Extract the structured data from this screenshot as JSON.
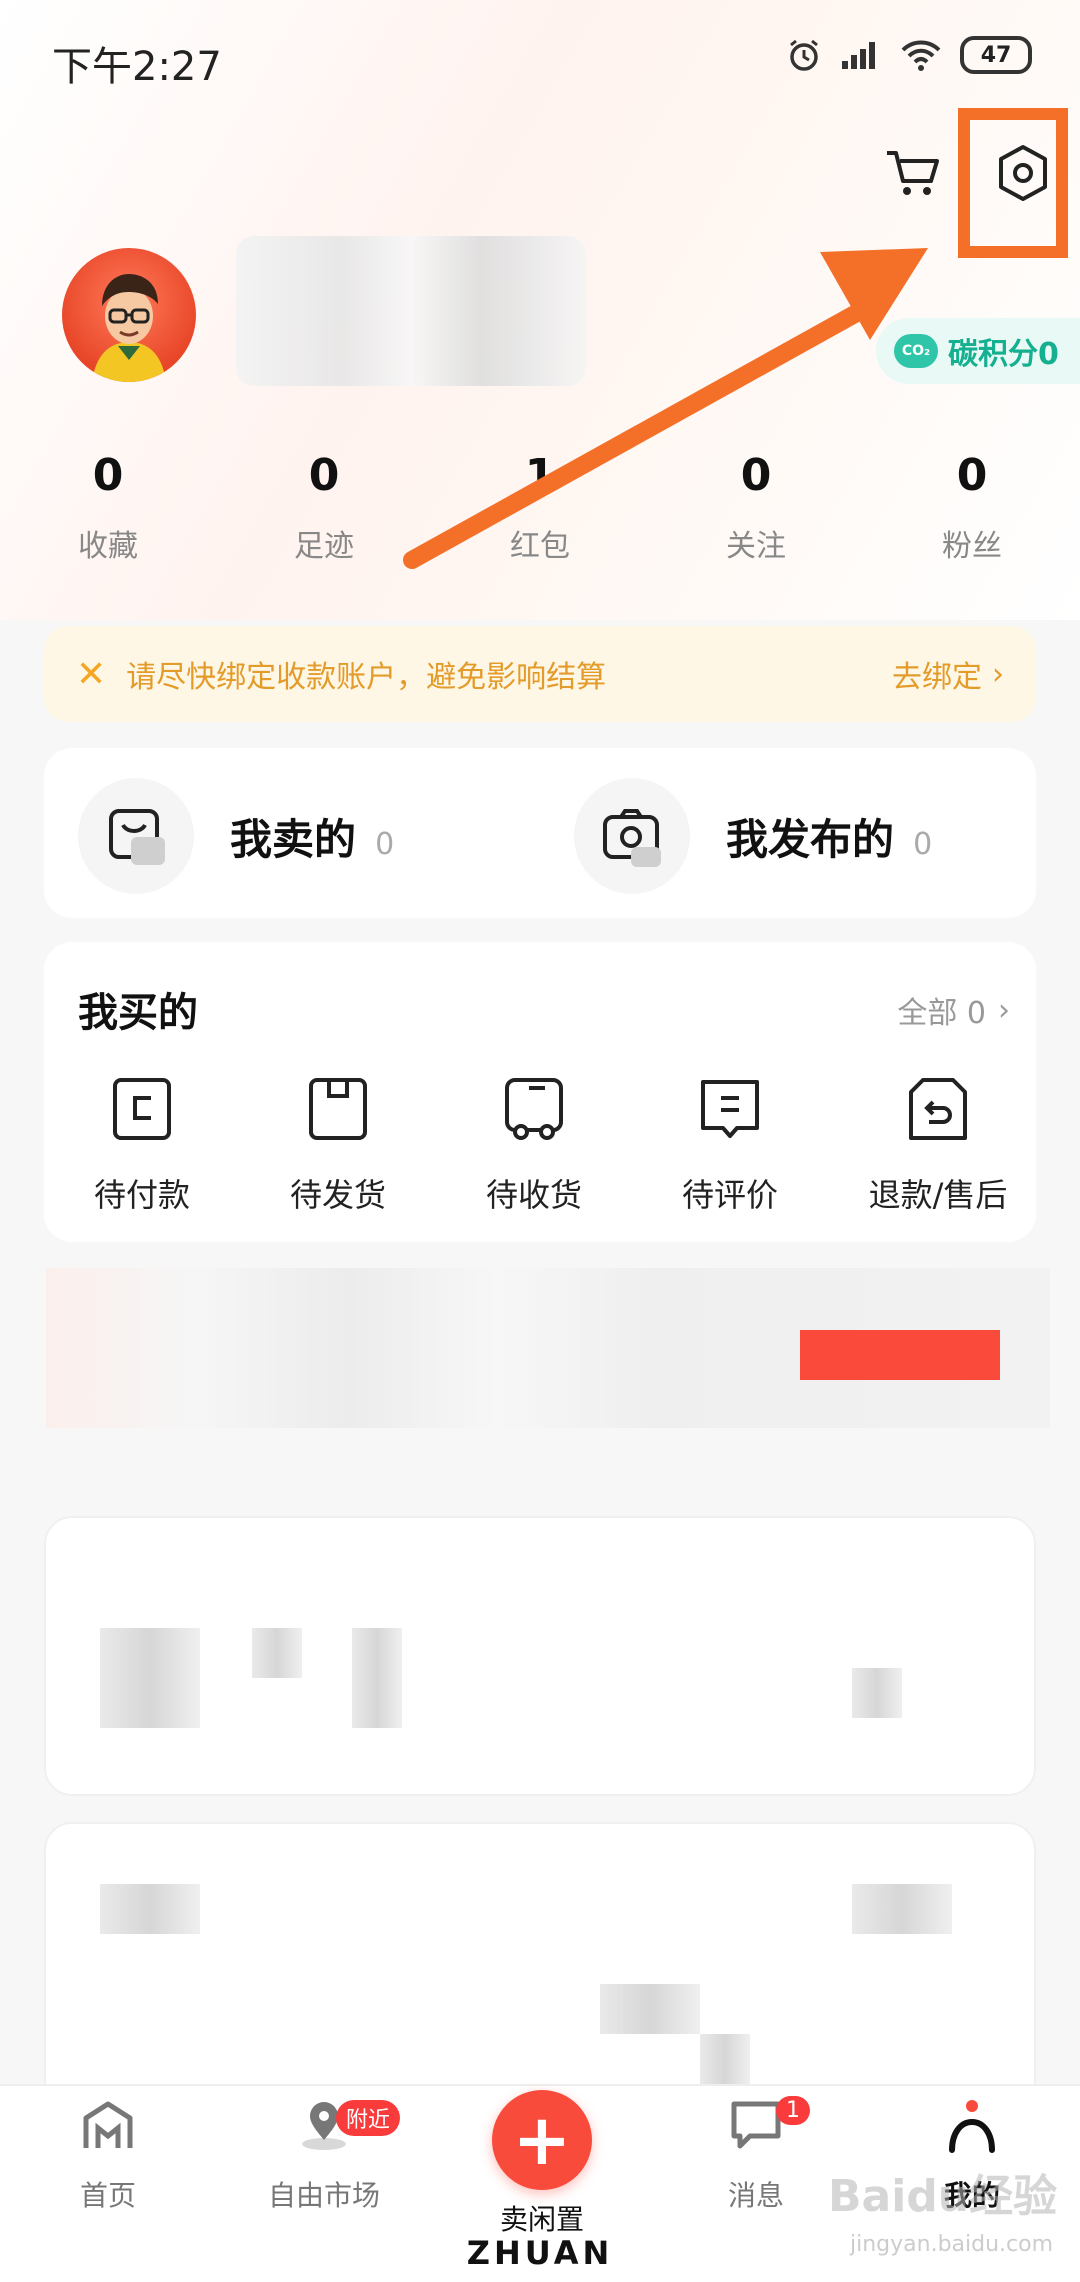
{
  "status_bar": {
    "time": "下午2:27",
    "battery": "47"
  },
  "profile": {
    "carbon_label": "碳积分0",
    "co2_text": "CO₂"
  },
  "stats": [
    {
      "value": "0",
      "label": "收藏"
    },
    {
      "value": "0",
      "label": "足迹"
    },
    {
      "value": "1",
      "label": "红包"
    },
    {
      "value": "0",
      "label": "关注"
    },
    {
      "value": "0",
      "label": "粉丝"
    }
  ],
  "notice": {
    "message": "请尽快绑定收款账户，避免影响结算",
    "action": "去绑定"
  },
  "sell_section": [
    {
      "label": "我卖的",
      "count": "0"
    },
    {
      "label": "我发布的",
      "count": "0"
    }
  ],
  "buy_section": {
    "title": "我买的",
    "all_label": "全部 0",
    "orders": [
      {
        "label": "待付款"
      },
      {
        "label": "待发货"
      },
      {
        "label": "待收货"
      },
      {
        "label": "待评价"
      },
      {
        "label": "退款/售后"
      }
    ]
  },
  "bottom_nav": {
    "items": [
      {
        "label": "首页"
      },
      {
        "label": "自由市场",
        "badge": "附近"
      },
      {
        "label": "卖闲置"
      },
      {
        "label": "消息",
        "badge": "1"
      },
      {
        "label": "我的"
      }
    ],
    "brand": "ZHUAN"
  },
  "watermark": {
    "main": "Baidu经验",
    "sub": "jingyan.baidu.com"
  },
  "colors": {
    "accent": "#f94b3b",
    "annotation": "#f46f28",
    "notice_text": "#e39b2a",
    "carbon": "#14b08f"
  }
}
